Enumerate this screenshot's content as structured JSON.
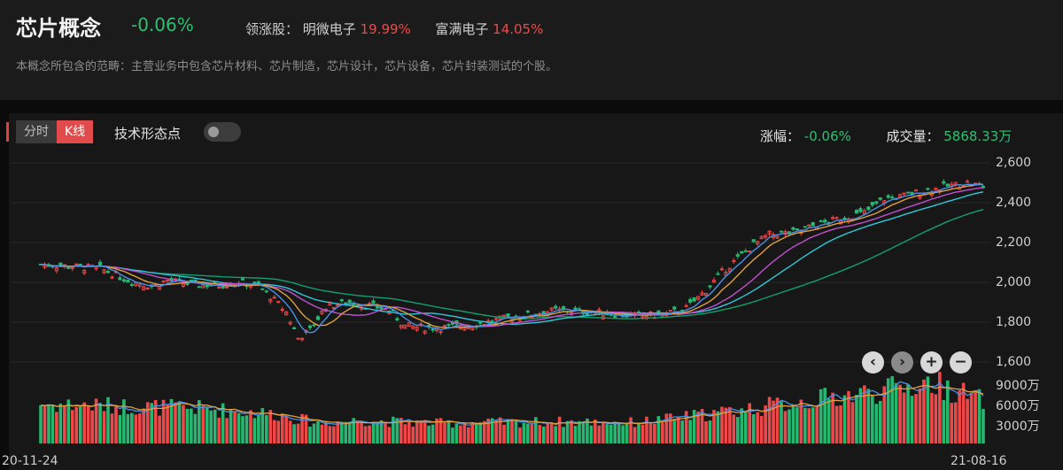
{
  "header": {
    "title": "芯片概念",
    "change": "-0.06%",
    "leaders_label": "领涨股：",
    "leaders": [
      {
        "name": "明微电子",
        "pct": "19.99%"
      },
      {
        "name": "富满电子",
        "pct": "14.05%"
      }
    ],
    "description": "本概念所包含的范畴：主营业务中包含芯片材料、芯片制造，芯片设计，芯片设备，芯片封装测试的个股。"
  },
  "toolbar": {
    "tabs": [
      {
        "label": "分时",
        "active": false
      },
      {
        "label": "K线",
        "active": true
      }
    ],
    "tech_label": "技术形态点",
    "tech_toggle_on": false,
    "zoom_buttons": [
      "prev",
      "next",
      "zoom-in",
      "zoom-out"
    ]
  },
  "stats": {
    "change_label": "涨幅：",
    "change_value": "-0.06%",
    "volume_label": "成交量：",
    "volume_value": "5868.33万"
  },
  "colors": {
    "up": "#f04848",
    "down": "#26b870",
    "ma5": "#4a90e8",
    "ma10": "#e0a040",
    "ma20": "#c050d0",
    "ma30": "#30c8d8",
    "ma60": "#10a070"
  },
  "chart_data": {
    "type": "candlestick",
    "x_start_label": "20-11-24",
    "x_end_label": "21-08-16",
    "price_axis": {
      "ticks": [
        "2,600",
        "2,400",
        "2,200",
        "2,000",
        "1,800",
        "1,600"
      ],
      "tick_values": [
        2600,
        2400,
        2200,
        2000,
        1800,
        1600
      ],
      "range": [
        1600,
        2600
      ]
    },
    "volume_axis": {
      "ticks": [
        "9000万",
        "6000万",
        "3000万"
      ],
      "tick_values": [
        9000,
        6000,
        3000
      ],
      "unit": "万"
    },
    "price_anchors": [
      [
        0,
        2090
      ],
      [
        8,
        2080
      ],
      [
        15,
        2070
      ],
      [
        22,
        2010
      ],
      [
        28,
        1980
      ],
      [
        32,
        2010
      ],
      [
        38,
        1990
      ],
      [
        45,
        1985
      ],
      [
        50,
        2000
      ],
      [
        55,
        1980
      ],
      [
        58,
        1930
      ],
      [
        62,
        1850
      ],
      [
        65,
        1720
      ],
      [
        68,
        1760
      ],
      [
        72,
        1880
      ],
      [
        78,
        1900
      ],
      [
        84,
        1880
      ],
      [
        88,
        1860
      ],
      [
        92,
        1780
      ],
      [
        100,
        1770
      ],
      [
        110,
        1790
      ],
      [
        120,
        1830
      ],
      [
        130,
        1860
      ],
      [
        140,
        1850
      ],
      [
        150,
        1830
      ],
      [
        158,
        1840
      ],
      [
        163,
        1870
      ],
      [
        168,
        1960
      ],
      [
        172,
        2050
      ],
      [
        176,
        2120
      ],
      [
        180,
        2190
      ],
      [
        184,
        2240
      ],
      [
        190,
        2250
      ],
      [
        196,
        2290
      ],
      [
        202,
        2320
      ],
      [
        208,
        2350
      ],
      [
        213,
        2420
      ],
      [
        217,
        2430
      ],
      [
        221,
        2450
      ],
      [
        228,
        2480
      ],
      [
        234,
        2500
      ],
      [
        238,
        2480
      ]
    ],
    "volume_anchors": [
      [
        0,
        5800
      ],
      [
        20,
        5500
      ],
      [
        40,
        5200
      ],
      [
        60,
        4300
      ],
      [
        70,
        3000
      ],
      [
        80,
        3400
      ],
      [
        100,
        3000
      ],
      [
        130,
        3200
      ],
      [
        150,
        3100
      ],
      [
        160,
        3700
      ],
      [
        180,
        5200
      ],
      [
        200,
        6800
      ],
      [
        215,
        8000
      ],
      [
        225,
        9000
      ],
      [
        238,
        6300
      ]
    ]
  }
}
